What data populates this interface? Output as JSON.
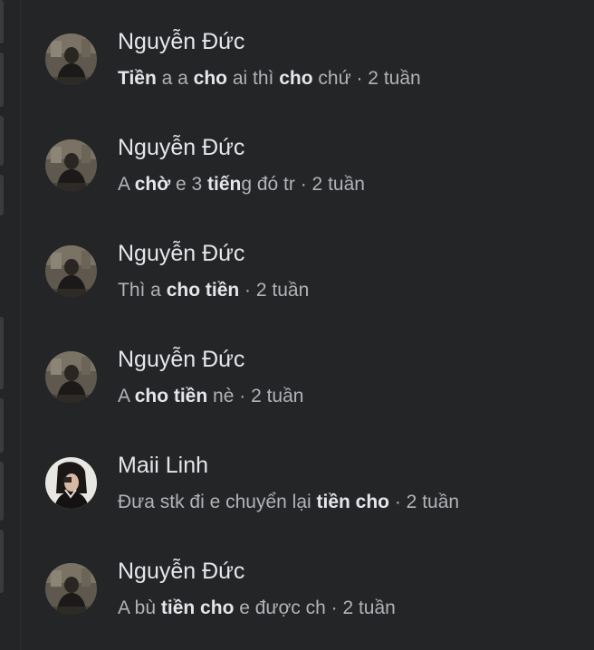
{
  "conversations": [
    {
      "name": "Nguyễn Đức",
      "avatar": "avatar-nguyen-duc",
      "snippet": [
        {
          "text": "Tiền",
          "bold": true
        },
        {
          "text": " a a ",
          "bold": false
        },
        {
          "text": "cho",
          "bold": true
        },
        {
          "text": " ai thì ",
          "bold": false
        },
        {
          "text": "cho",
          "bold": true
        },
        {
          "text": " chứ",
          "bold": false
        }
      ],
      "time": " · 2 tuần"
    },
    {
      "name": "Nguyễn Đức",
      "avatar": "avatar-nguyen-duc",
      "snippet": [
        {
          "text": "A ",
          "bold": false
        },
        {
          "text": "chờ",
          "bold": true
        },
        {
          "text": " e 3 ",
          "bold": false
        },
        {
          "text": "tiến",
          "bold": true
        },
        {
          "text": "g đó tr",
          "bold": false
        }
      ],
      "time": " · 2 tuần"
    },
    {
      "name": "Nguyễn Đức",
      "avatar": "avatar-nguyen-duc",
      "snippet": [
        {
          "text": "Thì a ",
          "bold": false
        },
        {
          "text": "cho tiền",
          "bold": true
        }
      ],
      "time": " · 2 tuần"
    },
    {
      "name": "Nguyễn Đức",
      "avatar": "avatar-nguyen-duc",
      "snippet": [
        {
          "text": "A ",
          "bold": false
        },
        {
          "text": "cho tiền",
          "bold": true
        },
        {
          "text": " nè",
          "bold": false
        }
      ],
      "time": " · 2 tuần"
    },
    {
      "name": "Maii Linh",
      "avatar": "avatar-maii-linh",
      "snippet": [
        {
          "text": "Đưa stk đi e chuyển lại ",
          "bold": false
        },
        {
          "text": "tiền cho",
          "bold": true
        }
      ],
      "time": " · 2 tuần"
    },
    {
      "name": "Nguyễn Đức",
      "avatar": "avatar-nguyen-duc",
      "snippet": [
        {
          "text": "A bù ",
          "bold": false
        },
        {
          "text": "tiền cho",
          "bold": true
        },
        {
          "text": " e được ch",
          "bold": false
        }
      ],
      "time": " · 2 tuần"
    }
  ],
  "colors": {
    "background": "#242526",
    "name_text": "#e4e6eb",
    "snippet_text": "#b0b3b8",
    "highlight_text": "#e4e6eb"
  }
}
